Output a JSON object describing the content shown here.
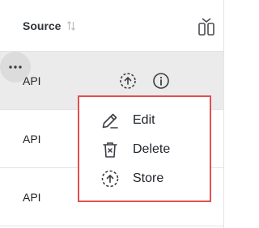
{
  "table": {
    "header": {
      "source_label": "Source"
    },
    "rows": [
      {
        "source": "API"
      },
      {
        "source": "API"
      },
      {
        "source": "API"
      }
    ]
  },
  "context_menu": {
    "items": [
      {
        "label": "Edit",
        "icon": "pencil-icon"
      },
      {
        "label": "Delete",
        "icon": "trash-icon"
      },
      {
        "label": "Store",
        "icon": "store-upload-icon"
      }
    ]
  },
  "colors": {
    "selected_row": "#ebebeb",
    "menu_highlight_border": "#e0504f",
    "more_button_bg": "#dcdcdc",
    "divider": "#e3e3e3"
  }
}
